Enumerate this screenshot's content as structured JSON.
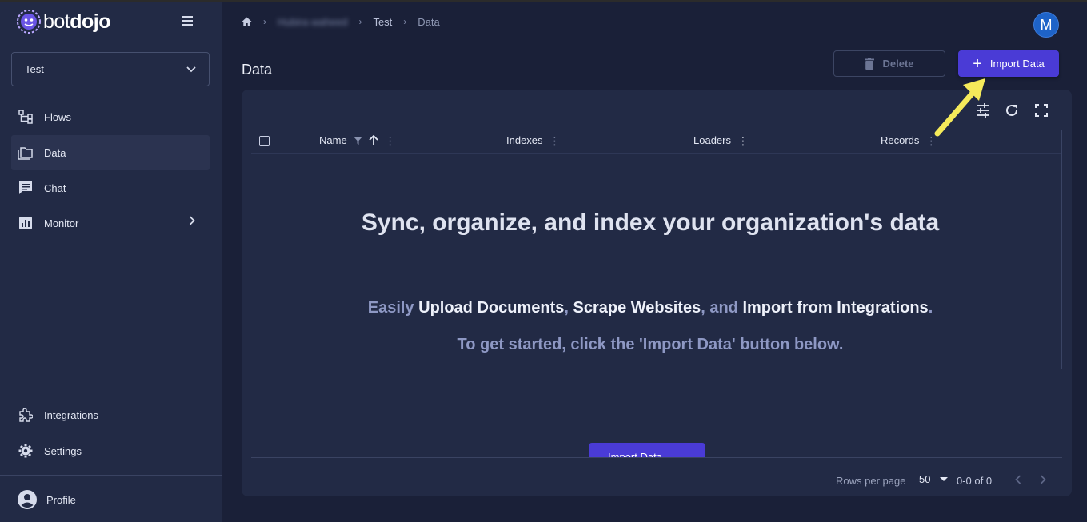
{
  "app": {
    "logo_text_bot": "bot",
    "logo_text_dojo": "dojo"
  },
  "sidebar": {
    "project": {
      "value": "Test"
    },
    "items": [
      {
        "label": "Flows",
        "icon": "flow-icon"
      },
      {
        "label": "Data",
        "icon": "folder-icon",
        "active": true
      },
      {
        "label": "Chat",
        "icon": "chat-icon"
      },
      {
        "label": "Monitor",
        "icon": "monitor-icon"
      }
    ],
    "bottom_items": [
      {
        "label": "Integrations",
        "icon": "puzzle-icon"
      },
      {
        "label": "Settings",
        "icon": "gear-icon"
      }
    ],
    "profile_label": "Profile"
  },
  "breadcrumb": {
    "org": "Hubira waheed",
    "project": "Test",
    "page": "Data"
  },
  "user": {
    "avatar_initial": "M"
  },
  "page": {
    "title": "Data",
    "delete_label": "Delete",
    "import_label": "Import Data"
  },
  "grid": {
    "columns": [
      "Name",
      "Indexes",
      "Loaders",
      "Records"
    ],
    "empty": {
      "headline": "Sync, organize, and index your organization's data",
      "line1_pre": "Easily",
      "line1_a": "Upload Documents",
      "line1_sep": ",",
      "line1_b": "Scrape Websites",
      "line1_and": ", and",
      "line1_c": "Import from Integrations",
      "line1_end": ".",
      "line2": "To get started, click the 'Import Data' button below.",
      "button_label": "Import Data"
    },
    "footer": {
      "rows_per_page_label": "Rows per page",
      "rows_per_page": "50",
      "range": "0-0 of 0"
    }
  },
  "colors": {
    "accent": "#4a3bd6",
    "background": "#1a2038",
    "sidebar": "#222a45",
    "highlight_arrow": "#f5ea5a"
  }
}
